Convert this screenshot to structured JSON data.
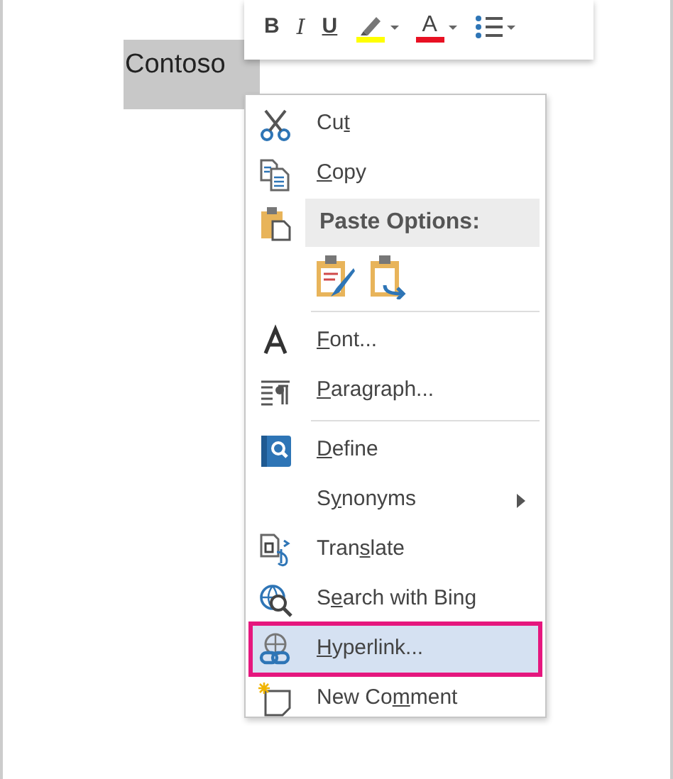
{
  "document": {
    "selected_text": "Contoso"
  },
  "mini_toolbar": [
    {
      "kind": "bold",
      "label": "B",
      "dropdown": false
    },
    {
      "kind": "italic",
      "label": "I",
      "dropdown": false
    },
    {
      "kind": "underline",
      "label": "U",
      "dropdown": false
    },
    {
      "kind": "highlight",
      "color": "#ffff00",
      "dropdown": true
    },
    {
      "kind": "font_color",
      "label": "A",
      "color": "#e81123",
      "dropdown": true
    },
    {
      "kind": "bullets",
      "dropdown": true
    }
  ],
  "context_menu": [
    {
      "kind": "cut",
      "before": "Cu",
      "key": "t",
      "submenu": false,
      "selected": false,
      "outlined": false
    },
    {
      "kind": "copy",
      "key": "C",
      "after": "opy",
      "submenu": false,
      "selected": false,
      "outlined": false
    },
    {
      "kind": "header",
      "label": "Paste Options:"
    },
    {
      "kind": "paste"
    },
    {
      "kind": "separator"
    },
    {
      "kind": "font",
      "key": "F",
      "after": "ont...",
      "submenu": false,
      "selected": false,
      "outlined": false
    },
    {
      "kind": "paragraph",
      "key": "P",
      "after": "aragraph...",
      "submenu": false,
      "selected": false,
      "outlined": false
    },
    {
      "kind": "separator"
    },
    {
      "kind": "define",
      "key": "D",
      "after": "efine",
      "submenu": false,
      "selected": false,
      "outlined": false
    },
    {
      "kind": "synonyms",
      "before": "S",
      "key": "y",
      "after": "nonyms",
      "submenu": true,
      "selected": false,
      "outlined": false
    },
    {
      "kind": "translate",
      "before": "Tran",
      "key": "s",
      "after": "late",
      "submenu": false,
      "selected": false,
      "outlined": false
    },
    {
      "kind": "search",
      "before": "S",
      "key": "e",
      "after": "arch with Bing",
      "submenu": false,
      "selected": false,
      "outlined": false
    },
    {
      "kind": "hyperlink",
      "key": "H",
      "after": "yperlink...",
      "submenu": false,
      "selected": true,
      "outlined": true
    },
    {
      "kind": "comment",
      "before": "New Co",
      "key": "m",
      "after": "ment",
      "submenu": false,
      "selected": false,
      "outlined": false
    }
  ]
}
